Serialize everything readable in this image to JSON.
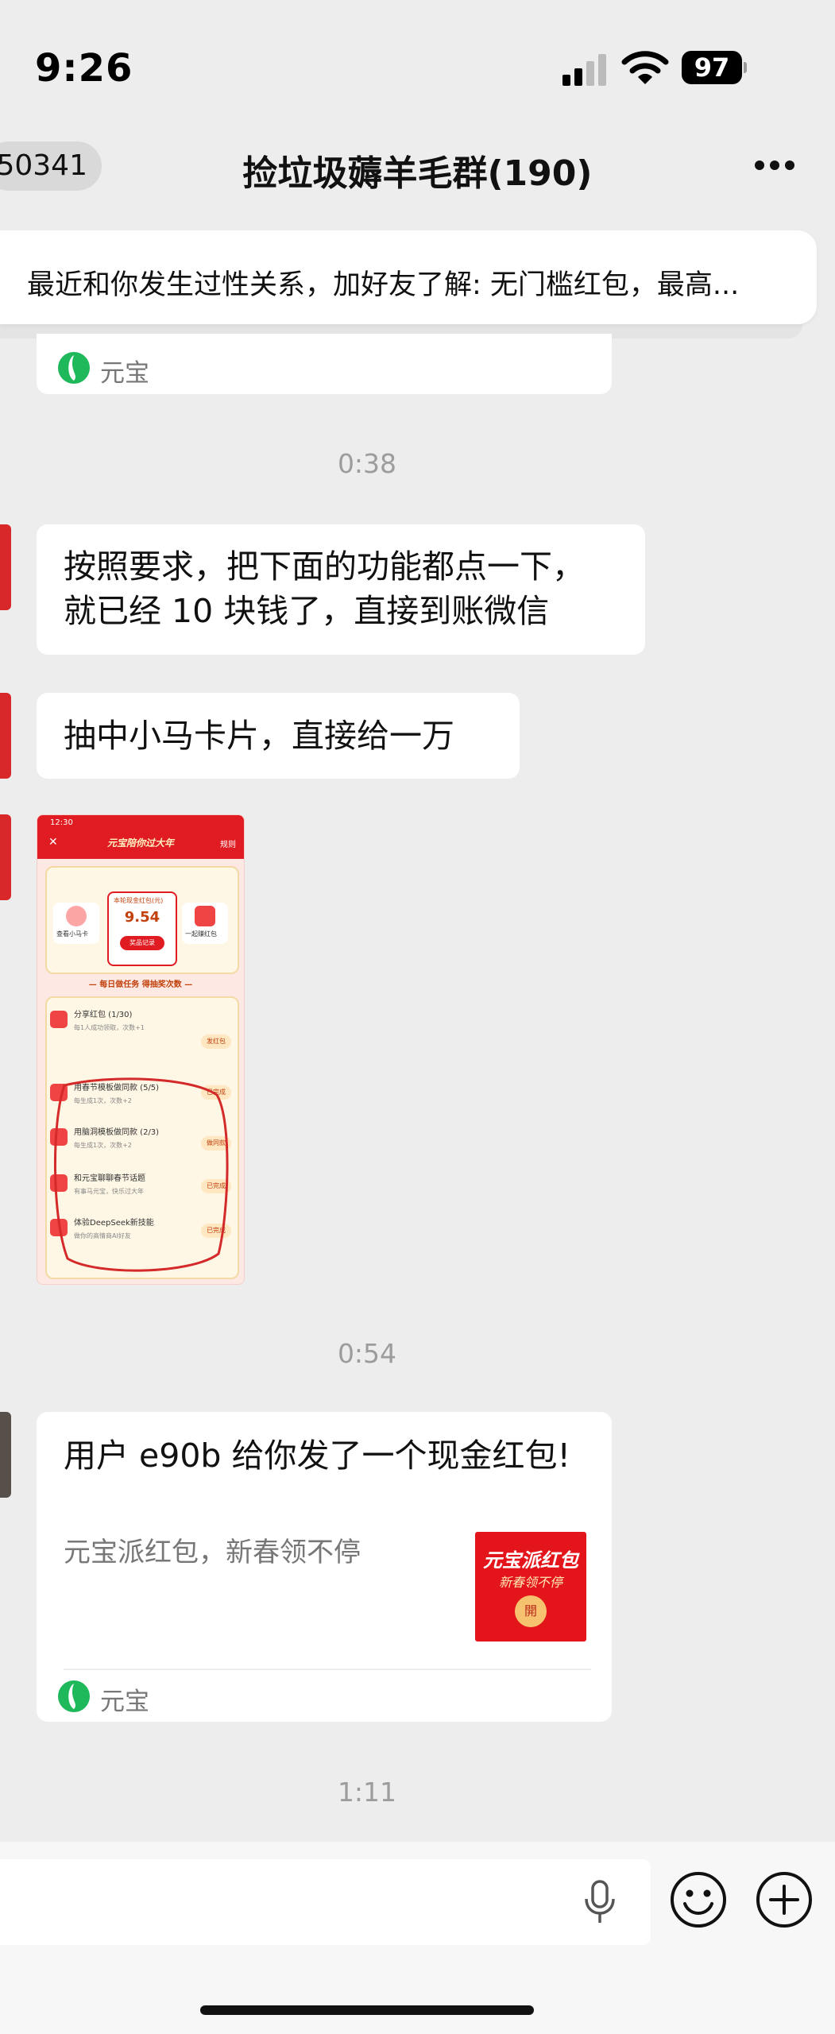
{
  "status_bar": {
    "time": "9:26",
    "battery": "97"
  },
  "nav": {
    "back_label": "50341",
    "title": "捡垃圾薅羊毛群(190)"
  },
  "pinned_notice": {
    "text": "最近和你发生过性关系，加好友了解: 无门槛红包，最高..."
  },
  "messages": {
    "top_card_source": "元宝",
    "ts1": "0:38",
    "m1_line1": "按照要求，把下面的功能都点一下，",
    "m1_line2": "就已经 10 块钱了，直接到账微信",
    "m2": "抽中小马卡片，直接给一万",
    "ts2": "0:54",
    "ts3": "1:11"
  },
  "thumbnail": {
    "time": "12:30",
    "title": "元宝陪你过大年",
    "rule": "规则",
    "left_tile": "查看小马卡",
    "center_label": "本轮现金红包(元)",
    "center_value": "9.54",
    "center_btn": "奖品记录",
    "right_tile": "一起赚红包",
    "section": "— 每日做任务 得抽奖次数 —",
    "tasks": [
      {
        "title": "分享红包 (1/30)",
        "desc": "每1人成功领取，次数+1",
        "btn": "发红包"
      },
      {
        "title": "用春节模板做同款 (5/5)",
        "desc": "每生成1次，次数+2",
        "btn": "已完成"
      },
      {
        "title": "用脑洞模板做同款 (2/3)",
        "desc": "每生成1次，次数+2",
        "btn": "做同款"
      },
      {
        "title": "和元宝聊聊春节话题",
        "desc": "有事马元宝，快乐过大年",
        "btn": "已完成"
      },
      {
        "title": "体验DeepSeek新技能",
        "desc": "做你的高情商AI好友",
        "btn": "已完成"
      }
    ]
  },
  "red_packet": {
    "title": "用户 e90b 给你发了一个现金红包!",
    "subtitle": "元宝派红包，新春领不停",
    "img_line1": "元宝派红包",
    "img_line2": "新春领不停",
    "img_coin": "開",
    "source": "元宝"
  },
  "colors": {
    "accent_red": "#e4141b",
    "bubble": "#ffffff",
    "background": "#ededed",
    "yuanbao_green": "#1fb85a"
  }
}
